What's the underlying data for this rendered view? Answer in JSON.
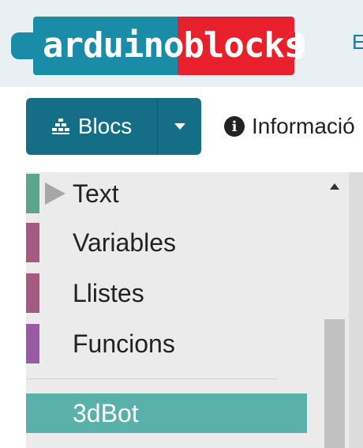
{
  "header": {
    "logo": {
      "part1": "arduin",
      "part2": "oblocks",
      "text": "arduinoblocks"
    },
    "cut_text": "E"
  },
  "toolbar": {
    "blocks_button": {
      "label": "Blocs",
      "icon": "blocks-icon"
    },
    "dropdown_icon": "caret-down-icon",
    "info_button": {
      "label": "Informació",
      "icon": "info-circle-icon"
    }
  },
  "toolbox": {
    "categories": [
      {
        "label": "Text",
        "color": "#5ba58c",
        "expandable": true
      },
      {
        "label": "Variables",
        "color": "#a55b80"
      },
      {
        "label": "Llistes",
        "color": "#a55b80"
      },
      {
        "label": "Funcions",
        "color": "#995ba5"
      }
    ],
    "selected": {
      "label": "3dBot",
      "color": "#5ab1ac"
    }
  },
  "colors": {
    "primary": "#146e86",
    "logo_blue": "#1b8ca8",
    "logo_red": "#e7202c"
  }
}
